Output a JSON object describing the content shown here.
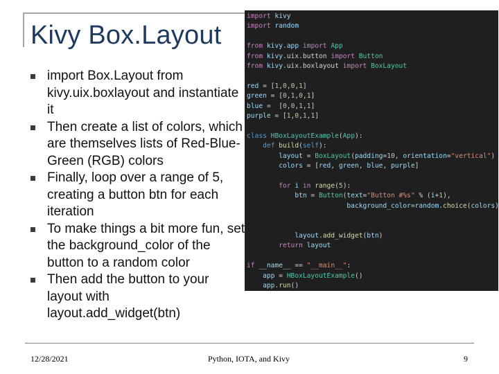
{
  "slide": {
    "title": "Kivy Box.Layout",
    "bullets": [
      "import Box.Layout from kivy.uix.boxlayout and instantiate it",
      "Then create a list of colors, which are themselves lists of Red-Blue-Green (RGB) colors",
      "Finally, loop over a range of 5, creating a button btn for each iteration",
      "To make things a bit more fun, set the background_color of the button to a random color",
      "Then add the button to your layout with layout.add_widget(btn)"
    ]
  },
  "code_lines": [
    "import kivy",
    "import random",
    "",
    "from kivy.app import App",
    "from kivy.uix.button import Button",
    "from kivy.uix.boxlayout import BoxLayout",
    "",
    "red = [1,0,0,1]",
    "green = [0,1,0,1]",
    "blue =  [0,0,1,1]",
    "purple = [1,0,1,1]",
    "",
    "class HBoxLayoutExample(App):",
    "    def build(self):",
    "        layout = BoxLayout(padding=10, orientation=\"vertical\")",
    "        colors = [red, green, blue, purple]",
    "",
    "        for i in range(5):",
    "            btn = Button(text=\"Button #%s\" % (i+1),",
    "                         background_color=random.choice(colors)",
    "",
    "",
    "            layout.add_widget(btn)",
    "        return layout",
    "",
    "if __name__ == \"__main__\":",
    "    app = HBoxLayoutExample()",
    "    app.run()"
  ],
  "footer": {
    "date": "12/28/2021",
    "center": "Python, IOTA, and Kivy",
    "page": "9"
  }
}
